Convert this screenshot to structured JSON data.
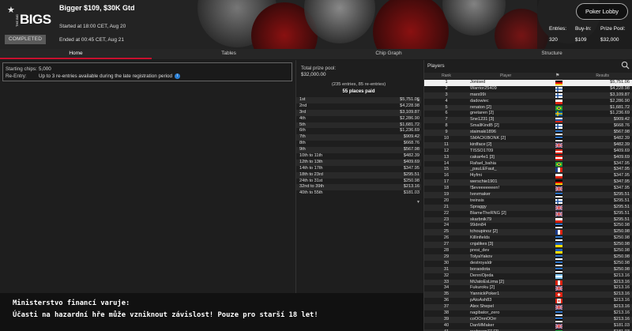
{
  "header": {
    "logo_small": "THE BIG",
    "logo_big": "BIGS",
    "status": "COMPLETED",
    "title": "Bigger $109, $30K Gtd",
    "started": "Started at 18:00 CET, Aug 20",
    "ended": "Ended at 00:45 CET, Aug 21",
    "lobby_button": "Poker Lobby",
    "stats": [
      {
        "label": "Entries:",
        "value": "320"
      },
      {
        "label": "Buy-In:",
        "value": "$109"
      },
      {
        "label": "Prize Pool:",
        "value": "$32,000"
      }
    ]
  },
  "tabs": [
    "Home",
    "Tables",
    "Chip Graph",
    "Structure"
  ],
  "home": {
    "chips_label": "Starting chips:",
    "chips_value": "5,000",
    "reentry_label": "Re-Entry:",
    "reentry_value": "Up to 3 re-entries available during the late registration period",
    "info_icon": "i"
  },
  "prize": {
    "pool_label": "Total prize pool:",
    "pool_value": "$32,000.00",
    "entries": "(235 entries, 85 re-entries)",
    "paid": "55 places paid",
    "rows": [
      [
        "1st",
        "$5,751.06"
      ],
      [
        "2nd",
        "$4,228.98"
      ],
      [
        "3rd",
        "$3,109.87"
      ],
      [
        "4th",
        "$2,286.90"
      ],
      [
        "5th",
        "$1,681.72"
      ],
      [
        "6th",
        "$1,236.69"
      ],
      [
        "7th",
        "$909.42"
      ],
      [
        "8th",
        "$668.76"
      ],
      [
        "9th",
        "$567.98"
      ],
      [
        "10th to 11th",
        "$482.39"
      ],
      [
        "12th to 13th",
        "$409.69"
      ],
      [
        "14th to 17th",
        "$347.95"
      ],
      [
        "18th to 23rd",
        "$295.51"
      ],
      [
        "24th to 31st",
        "$250.98"
      ],
      [
        "32nd to 39th",
        "$213.16"
      ],
      [
        "40th to 55th",
        "$181.03"
      ]
    ]
  },
  "players": {
    "title": "Players",
    "columns": [
      "Rank",
      "Player",
      "",
      "Results"
    ],
    "rows": [
      [
        "1",
        "Jonised",
        "$5,751.06",
        "de"
      ],
      [
        "2",
        "Warrior25409",
        "$4,228.98",
        "fi"
      ],
      [
        "3",
        "mars99i",
        "$3,109.87",
        "fi"
      ],
      [
        "4",
        "dadowiec",
        "$2,286.90",
        "pl"
      ],
      [
        "5",
        "renaton [2]",
        "$1,681.72",
        "br"
      ],
      [
        "6",
        "gnetaren [2]",
        "$1,236.69",
        "se"
      ],
      [
        "7",
        "Sne1231 [3]",
        "$909.42",
        "sk"
      ],
      [
        "8",
        "SmallKindB [2]",
        "$668.76",
        "fi"
      ],
      [
        "9",
        "staimaki1896",
        "$567.98",
        "ee"
      ],
      [
        "10",
        "SMACKIBONK [2]",
        "$482.39",
        "ee"
      ],
      [
        "11",
        "kirdface [2]",
        "$482.39",
        "gb"
      ],
      [
        "12",
        "TISSO1709",
        "$409.69",
        "at"
      ],
      [
        "13",
        "cakar4e1 [3]",
        "$409.69",
        "at"
      ],
      [
        "14",
        "Rafael_bahia",
        "$347.95",
        "br"
      ],
      [
        "15",
        "_pauLEFaut_",
        "$347.95",
        "fr"
      ],
      [
        "16",
        "f4yfmi",
        "$347.95",
        "pl"
      ],
      [
        "17",
        "werschie1901",
        "$347.95",
        "de"
      ],
      [
        "18",
        "!$eveeeeeeen!",
        "$347.95",
        "gb"
      ],
      [
        "19",
        "Ivevmaker",
        "$295.51",
        "ee"
      ],
      [
        "20",
        "treinsis",
        "$295.51",
        "fi"
      ],
      [
        "21",
        "Spraggy",
        "$295.51",
        "gb"
      ],
      [
        "22",
        "BlameTheRNG [2]",
        "$295.51",
        "gb"
      ],
      [
        "23",
        "skarbnik79",
        "$295.51",
        "pl"
      ],
      [
        "24",
        "99dm84",
        "$250.98",
        "ee"
      ],
      [
        "25",
        "tchoupinoz [2]",
        "$250.98",
        "fr"
      ],
      [
        "26",
        "Killinfields",
        "$250.98",
        "ee"
      ],
      [
        "27",
        "cnjalikes [3]",
        "$250.98",
        "ua"
      ],
      [
        "28",
        "presi_dev",
        "$250.98",
        "ua"
      ],
      [
        "29",
        "TolyaYakov",
        "$250.98",
        "ee"
      ],
      [
        "30",
        "destroyaIdr",
        "$250.98",
        "ee"
      ],
      [
        "31",
        "boraodota",
        "$250.98",
        "ee"
      ],
      [
        "32",
        "DenniOjeda",
        "$213.16",
        "ar"
      ],
      [
        "33",
        "MiJatoEsLima [2]",
        "$213.16",
        "pe"
      ],
      [
        "34",
        "Fukuroku [2]",
        "$213.16",
        "gb"
      ],
      [
        "35",
        "YannickPoker1",
        "$213.16",
        "ch"
      ],
      [
        "36",
        "pAtoAsh83",
        "$213.16",
        "ca"
      ],
      [
        "37",
        "Alex Shepel",
        "$213.16",
        "gb"
      ],
      [
        "38",
        "nagibator_zero",
        "$213.16",
        "ee"
      ],
      [
        "39",
        "coOOnnOOrr",
        "$213.16",
        "ee"
      ],
      [
        "40",
        "DanMMaker",
        "$181.03",
        "gb"
      ],
      [
        "41",
        "rsehnem77 [2]",
        "$181.03",
        "br"
      ]
    ]
  },
  "warning": {
    "line1": "Ministerstvo financí varuje:",
    "line2": "Účasti na hazardní hře může vzniknout závislost! Pouze pro starší 18 let!"
  },
  "colors": {
    "accent": "#c8102e",
    "background": "#1c1c1c",
    "highlight_row": "#f2f2f2"
  }
}
